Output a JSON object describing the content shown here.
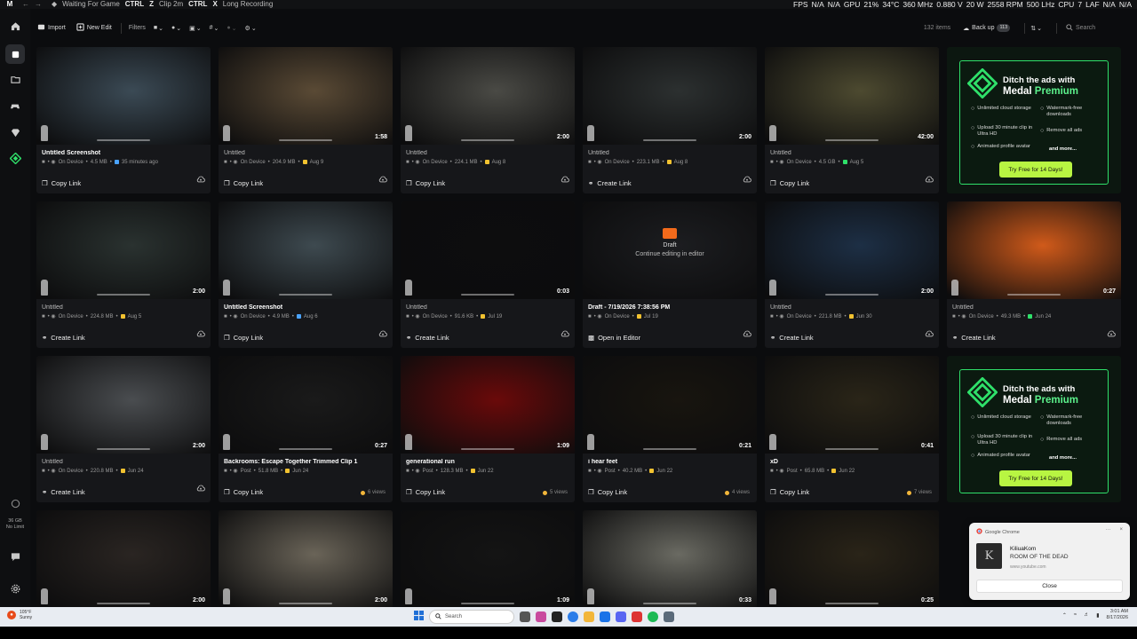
{
  "topbar": {
    "logo": "M",
    "back": "←",
    "forward": "→",
    "status": "Waiting For Game",
    "shortcuts": [
      {
        "key": "CTRL",
        "sep": "Z",
        "label": "Clip 2m"
      },
      {
        "key": "CTRL",
        "sep": "X",
        "label": "Long Recording"
      }
    ],
    "stats": [
      "FPS",
      "N/A",
      "N/A",
      "GPU",
      "21%",
      "34°C",
      "360 MHz",
      "0.880 V",
      "20 W",
      "2558 RPM",
      "500 LHz",
      "CPU",
      "7",
      "LAF",
      "N/A",
      "N/A"
    ]
  },
  "toolbar": {
    "import": "Import",
    "new_edit": "New Edit",
    "filters": "Filters",
    "item_count": "132 items",
    "backup": "Back up",
    "backup_badge": "113",
    "search_placeholder": "Search"
  },
  "sidebar": {
    "storage": "36 GB",
    "limit": "No Limit"
  },
  "cards": [
    {
      "title": "Untitled Screenshot",
      "bold": true,
      "loc": "On Device",
      "size": "4.5 MB",
      "date": "35 minutes ago",
      "date_color": "#4aa3ff",
      "action": "Copy Link",
      "duration": "",
      "thumb": "#3b4a55"
    },
    {
      "title": "Untitled",
      "bold": false,
      "loc": "On Device",
      "size": "204.9 MB",
      "date": "Aug 9",
      "date_color": "#f2c230",
      "action": "Copy Link",
      "duration": "1:58",
      "thumb": "#5a4a35"
    },
    {
      "title": "Untitled",
      "bold": false,
      "loc": "On Device",
      "size": "224.1 MB",
      "date": "Aug 8",
      "date_color": "#f2c230",
      "action": "Copy Link",
      "duration": "2:00",
      "thumb": "#4a4a45"
    },
    {
      "title": "Untitled",
      "bold": false,
      "loc": "On Device",
      "size": "223.1 MB",
      "date": "Aug 8",
      "date_color": "#f2c230",
      "action": "Create Link",
      "duration": "2:00",
      "thumb": "#2c3030"
    },
    {
      "title": "Untitled",
      "bold": false,
      "loc": "On Device",
      "size": "4.5 GB",
      "date": "Aug 5",
      "date_color": "#2fe06a",
      "action": "Copy Link",
      "duration": "42:00",
      "thumb": "#4d4a30"
    },
    {
      "title": "Untitled",
      "bold": false,
      "loc": "On Device",
      "size": "224.8 MB",
      "date": "Aug 5",
      "date_color": "#f2c230",
      "action": "Create Link",
      "duration": "2:00",
      "thumb": "#2a3230"
    },
    {
      "title": "Untitled Screenshot",
      "bold": true,
      "loc": "On Device",
      "size": "4.9 MB",
      "date": "Aug 6",
      "date_color": "#4aa3ff",
      "action": "Copy Link",
      "duration": "",
      "thumb": "#3e4a50"
    },
    {
      "title": "Untitled",
      "bold": false,
      "loc": "On Device",
      "size": "91.6 KB",
      "date": "Jul 19",
      "date_color": "#f2c230",
      "action": "Create Link",
      "duration": "0:03",
      "thumb": "#0d0d0e"
    },
    {
      "title": "Draft - 7/19/2026 7:38:56 PM",
      "bold": true,
      "loc": "On Device",
      "size": "",
      "date": "Jul 19",
      "date_color": "#f2c230",
      "action": "Open in Editor",
      "duration": "",
      "thumb": "#1c1d20",
      "draft": true,
      "draft_label": "Draft",
      "draft_sub": "Continue editing in editor"
    },
    {
      "title": "Untitled",
      "bold": false,
      "loc": "On Device",
      "size": "221.8 MB",
      "date": "Jun 30",
      "date_color": "#f2c230",
      "action": "Create Link",
      "duration": "2:00",
      "thumb": "#1d2f45"
    },
    {
      "title": "Untitled",
      "bold": false,
      "loc": "On Device",
      "size": "49.3 MB",
      "date": "Jun 24",
      "date_color": "#2fe06a",
      "action": "Create Link",
      "duration": "0:27",
      "thumb": "#d05a1a"
    },
    {
      "title": "Untitled",
      "bold": false,
      "loc": "On Device",
      "size": "220.8 MB",
      "date": "Jun 24",
      "date_color": "#f2c230",
      "action": "Create Link",
      "duration": "2:00",
      "thumb": "#4a4d50"
    },
    {
      "title": "Backrooms: Escape Together Trimmed Clip 1",
      "bold": true,
      "loc": "Post",
      "size": "51.8 MB",
      "date": "Jun 24",
      "date_color": "#f2c230",
      "action": "Copy Link",
      "duration": "0:27",
      "thumb": "#1a1a1a",
      "views": "6 views"
    },
    {
      "title": "generational run",
      "bold": true,
      "loc": "Post",
      "size": "128.3 MB",
      "date": "Jun 22",
      "date_color": "#f2c230",
      "action": "Copy Link",
      "duration": "1:09",
      "thumb": "#6a0a0a",
      "views": "5 views"
    },
    {
      "title": "i hear feet",
      "bold": true,
      "loc": "Post",
      "size": "40.2 MB",
      "date": "Jun 22",
      "date_color": "#f2c230",
      "action": "Copy Link",
      "duration": "0:21",
      "thumb": "#18150f",
      "views": "4 views"
    },
    {
      "title": "xD",
      "bold": true,
      "loc": "Post",
      "size": "65.8 MB",
      "date": "Jun 22",
      "date_color": "#f2c230",
      "action": "Copy Link",
      "duration": "0:41",
      "thumb": "#2a2518",
      "views": "7 views"
    },
    {
      "title": "",
      "bold": false,
      "loc": "",
      "size": "",
      "date": "",
      "date_color": "#f2c230",
      "action": "",
      "duration": "2:00",
      "thumb": "#2a2522"
    },
    {
      "title": "",
      "bold": false,
      "loc": "",
      "size": "",
      "date": "",
      "date_color": "#f2c230",
      "action": "",
      "duration": "2:00",
      "thumb": "#6a6458"
    },
    {
      "title": "",
      "bold": false,
      "loc": "",
      "size": "",
      "date": "",
      "date_color": "#f2c230",
      "action": "",
      "duration": "1:09",
      "thumb": "#141414"
    },
    {
      "title": "",
      "bold": false,
      "loc": "",
      "size": "",
      "date": "",
      "date_color": "#f2c230",
      "action": "",
      "duration": "0:33",
      "thumb": "#6a6a62"
    },
    {
      "title": "",
      "bold": false,
      "loc": "",
      "size": "",
      "date": "",
      "date_color": "#f2c230",
      "action": "",
      "duration": "0:25",
      "thumb": "#2a2418"
    }
  ],
  "promo": {
    "title_line1": "Ditch the ads with",
    "title_line2a": "Medal",
    "title_line2b": "Premium",
    "features": [
      "Unlimited cloud storage",
      "Watermark-free downloads",
      "Upload 30 minute clip in Ultra HD",
      "Remove all ads",
      "Animated profile avatar",
      "and more..."
    ],
    "cta": "Try Free for 14 Days!"
  },
  "notification": {
    "app": "Google Chrome",
    "title": "KiliuaKom",
    "body": "ROOM OF THE DEAD",
    "source": "www.youtube.com",
    "close": "Close"
  },
  "taskbar": {
    "temp": "105°F",
    "weather": "Sunny",
    "search": "Search",
    "time": "3:01 AM",
    "date": "8/17/2026"
  }
}
